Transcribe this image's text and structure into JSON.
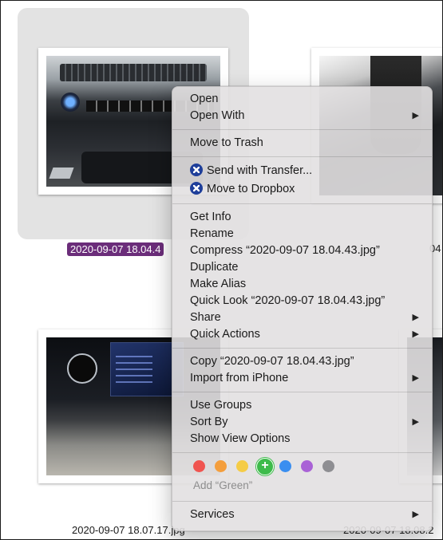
{
  "files": {
    "selected": "2020-09-07 18.04.43.jpg",
    "selected_visible": "2020-09-07 18.04.4",
    "top_right_partial": "04",
    "bottom_left": "2020-09-07 18.07.17.jpg",
    "bottom_right_partial": "2020-09-07 18.08.2"
  },
  "context_menu": {
    "open": "Open",
    "open_with": "Open With",
    "move_to_trash": "Move to Trash",
    "send_with_transfer": "Send with Transfer...",
    "move_to_dropbox": "Move to Dropbox",
    "get_info": "Get Info",
    "rename": "Rename",
    "compress": "Compress “2020-09-07 18.04.43.jpg”",
    "duplicate": "Duplicate",
    "make_alias": "Make Alias",
    "quick_look": "Quick Look “2020-09-07 18.04.43.jpg”",
    "share": "Share",
    "quick_actions": "Quick Actions",
    "copy": "Copy “2020-09-07 18.04.43.jpg”",
    "import_from_iphone": "Import from iPhone",
    "use_groups": "Use Groups",
    "sort_by": "Sort By",
    "show_view_options": "Show View Options",
    "add_tag_hint": "Add “Green”",
    "services": "Services",
    "submenu_arrow": "▶"
  },
  "tags": [
    {
      "name": "red",
      "color": "#f0544f"
    },
    {
      "name": "orange",
      "color": "#f49e3c"
    },
    {
      "name": "yellow",
      "color": "#f5cc46"
    },
    {
      "name": "green",
      "color": "#3dbb4a"
    },
    {
      "name": "blue",
      "color": "#3a8ef0"
    },
    {
      "name": "purple",
      "color": "#a962d6"
    },
    {
      "name": "gray",
      "color": "#8e8e92"
    }
  ],
  "colors": {
    "selection_label_bg": "#6b2d7a",
    "dropbox_icon": "#1f3f9a"
  }
}
